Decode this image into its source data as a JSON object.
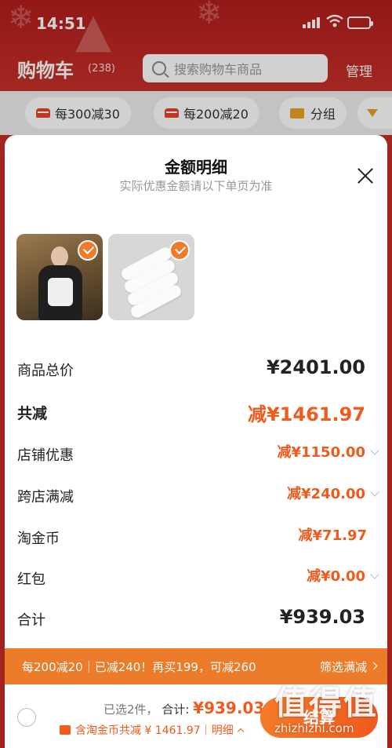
{
  "status_bar": {
    "time": "14:51"
  },
  "cart_page": {
    "title": "购物车",
    "count": "(238)",
    "search_placeholder": "搜索购物车商品",
    "manage_label": "管理",
    "chips": [
      "每300减30",
      "每200减20",
      "分组"
    ]
  },
  "sheet": {
    "title": "金额明细",
    "subtitle": "实际优惠金额请以下单页为准",
    "items": [
      {
        "name": "jacket-product",
        "checked": true
      },
      {
        "name": "socks-product",
        "checked": true
      }
    ],
    "rows": {
      "total_price": {
        "label": "商品总价",
        "value": "¥2401.00"
      },
      "total_discount": {
        "label": "共减",
        "value": "减¥1461.97"
      },
      "store_discount": {
        "label": "店铺优惠",
        "value": "减¥1150.00"
      },
      "cross_store": {
        "label": "跨店满减",
        "value": "减¥240.00"
      },
      "taobao_coin": {
        "label": "淘金币",
        "value": "减¥71.97"
      },
      "red_packet": {
        "label": "红包",
        "value": "减¥0.00"
      },
      "grand_total": {
        "label": "合计",
        "value": "¥939.03"
      }
    },
    "promo": {
      "text": "每200减20｜已减240！再买199，可减260",
      "action": "筛选满减"
    }
  },
  "footer": {
    "selected_count": "已选2件，",
    "total_label": "合计:",
    "total_value": "¥939.03",
    "discount_text": "含淘金币共减 ¥ 1461.97｜明细",
    "checkout_label": "结算"
  },
  "watermark": {
    "title": "值得值",
    "url": "zhizhizhi.com"
  },
  "colors": {
    "accent": "#f05a1c",
    "promo_bg": "#ec7c29",
    "header_red": "#c62a24"
  }
}
